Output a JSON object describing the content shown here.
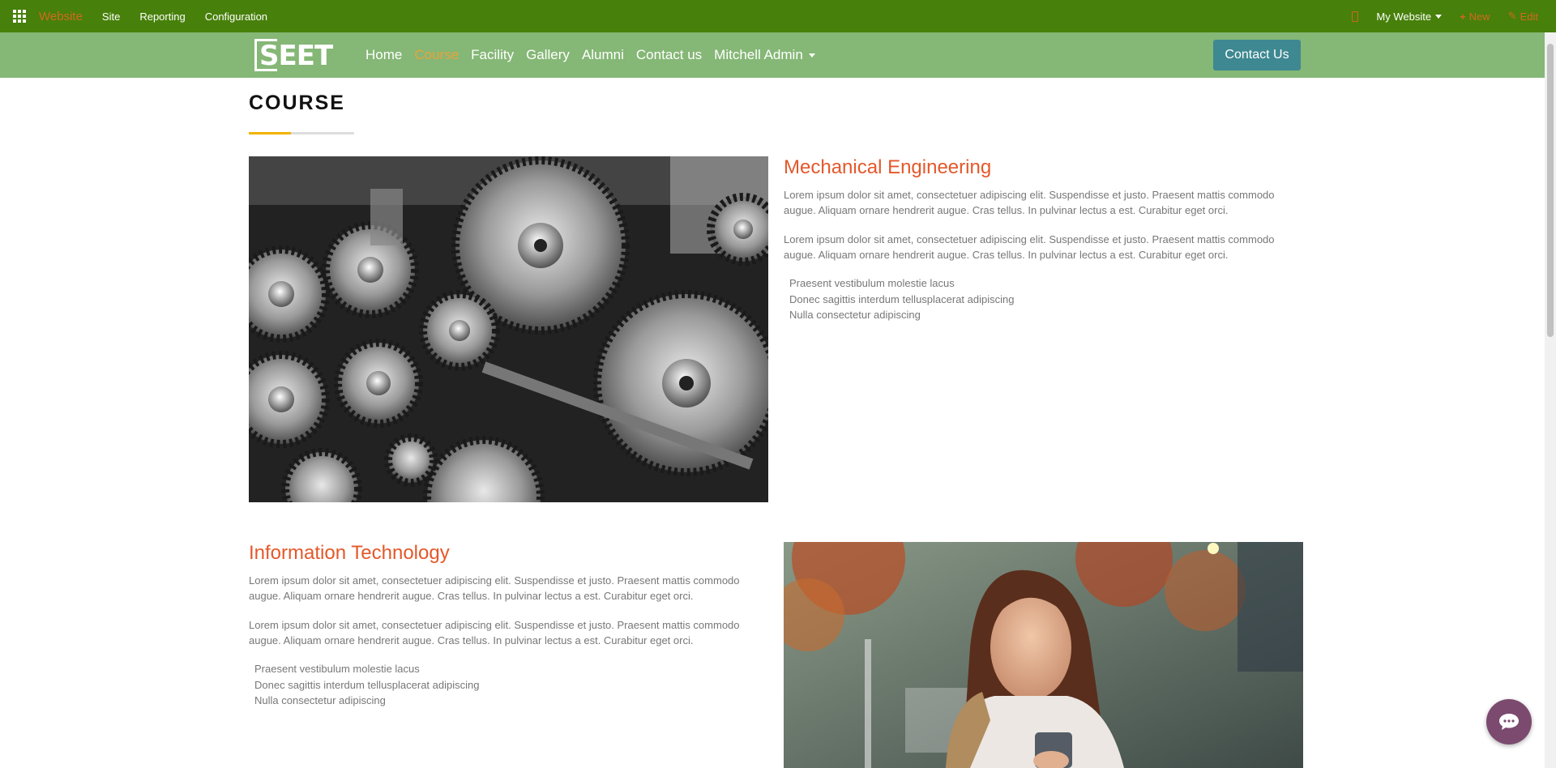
{
  "topbar": {
    "app_name": "Website",
    "menus": [
      "Site",
      "Reporting",
      "Configuration"
    ],
    "website_selector": "My Website",
    "new_label": "New",
    "edit_label": "Edit"
  },
  "navbar": {
    "logo_text": "SEET",
    "links": [
      "Home",
      "Course",
      "Facility",
      "Gallery",
      "Alumni",
      "Contact us",
      "Mitchell Admin"
    ],
    "active_link": "Course",
    "cta_label": "Contact Us"
  },
  "page": {
    "title": "COURSE",
    "courses": [
      {
        "name": "Mechanical Engineering",
        "para1": "Lorem ipsum dolor sit amet, consectetuer adipiscing elit. Suspendisse et justo. Praesent mattis commodo augue. Aliquam ornare hendrerit augue. Cras tellus. In pulvinar lectus a est. Curabitur eget orci.",
        "para2": "Lorem ipsum dolor sit amet, consectetuer adipiscing elit. Suspendisse et justo. Praesent mattis commodo augue. Aliquam ornare hendrerit augue. Cras tellus. In pulvinar lectus a est. Curabitur eget orci.",
        "list": [
          "Praesent vestibulum molestie lacus",
          "Donec sagittis interdum tellusplacerat adipiscing",
          "Nulla consectetur adipiscing"
        ]
      },
      {
        "name": "Information Technology",
        "para1": "Lorem ipsum dolor sit amet, consectetuer adipiscing elit. Suspendisse et justo. Praesent mattis commodo augue. Aliquam ornare hendrerit augue. Cras tellus. In pulvinar lectus a est. Curabitur eget orci.",
        "para2": "Lorem ipsum dolor sit amet, consectetuer adipiscing elit. Suspendisse et justo. Praesent mattis commodo augue. Aliquam ornare hendrerit augue. Cras tellus. In pulvinar lectus a est. Curabitur eget orci.",
        "list": [
          "Praesent vestibulum molestie lacus",
          "Donec sagittis interdum tellusplacerat adipiscing",
          "Nulla consectetur adipiscing"
        ]
      }
    ]
  },
  "colors": {
    "topbar": "#47800a",
    "navbar": "#85b776",
    "accent_orange": "#e4582a",
    "cta": "#3e8891",
    "underline": "#f2b300"
  },
  "icons": [
    "apps-grid-icon",
    "mobile-preview-icon",
    "plus-icon",
    "pencil-icon",
    "chat-bubble-icon",
    "gears-photo",
    "girl-phone-photo"
  ]
}
